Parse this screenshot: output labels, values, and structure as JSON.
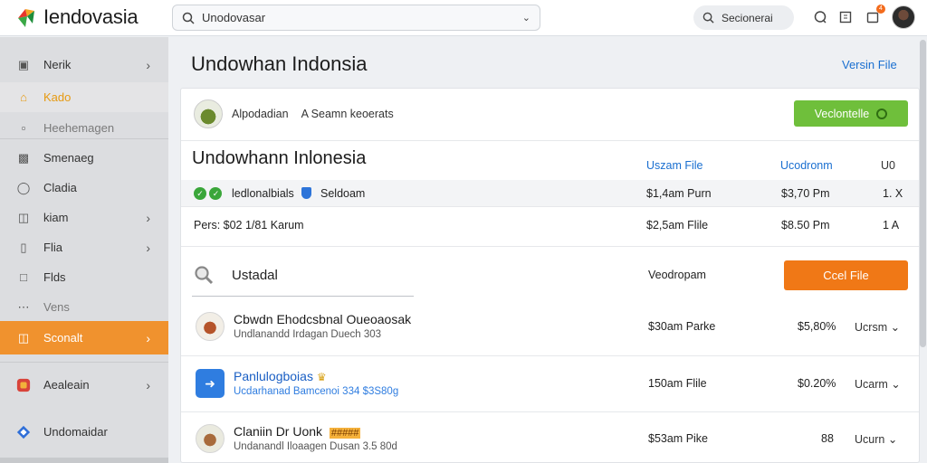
{
  "app": {
    "name": "Iendovasia",
    "search_value": "Unodovasar",
    "pill_label": "Secionerai",
    "notification_count": "4"
  },
  "sidebar": {
    "items": [
      {
        "label": "Nerik",
        "icon": "square-icon"
      },
      {
        "label": "Kado",
        "icon": "home-icon"
      },
      {
        "label": "Heehemagen",
        "icon": "folder-icon"
      },
      {
        "label": "Smenaeg",
        "icon": "grid-icon"
      },
      {
        "label": "Cladia",
        "icon": "circle-icon"
      },
      {
        "label": "kiam",
        "icon": "tag-icon"
      },
      {
        "label": "Flia",
        "icon": "file-icon"
      },
      {
        "label": "Flds",
        "icon": "box-icon"
      },
      {
        "label": "Vens",
        "icon": "dots-icon"
      },
      {
        "label": "Sconalt",
        "icon": "layers-icon"
      },
      {
        "label": "Aealeain",
        "icon": "app-icon"
      },
      {
        "label": "Undomaidar",
        "icon": "diamond-icon"
      }
    ]
  },
  "main": {
    "title": "Undowhan Indonsia",
    "version_link": "Versin File"
  },
  "card": {
    "header_name": "Alpodadian",
    "header_tag": "A  Seamn keoerats",
    "green_button": "Veclontelle",
    "subtitle": "Undowhann Inlonesia",
    "columns": [
      "Uszam File",
      "Ucodronm",
      "U0"
    ],
    "rows": [
      {
        "name": "ledlonalbials",
        "tag": "Seldoam",
        "c1": "$1,4am Purn",
        "c2": "$3,70 Pm",
        "c3": "1. X"
      },
      {
        "name": "Pers:  $02 1/81 Karum",
        "tag": "",
        "c1": "$2,5am Flile",
        "c2": "$8.50 Pm",
        "c3": "1 A"
      }
    ],
    "search_label": "Ustadal",
    "vd_label": "Veodropam",
    "orange_button": "Ccel File",
    "list": [
      {
        "title": "Cbwdn Ehodcsbnal Oueoaosak",
        "sub": "Undlanandd Irdagan Duech 303",
        "c1": "$30am Parke",
        "c2": "$5,80%",
        "c3": "Ucrsm",
        "highlight": ""
      },
      {
        "title": "Panlulogboias",
        "sub": "Ucdarhanad Bamcenoi 334 $3S80g",
        "c1": "150am Flile",
        "c2": "$0.20%",
        "c3": "Ucarm",
        "highlight": ""
      },
      {
        "title": "Claniin Dr Uonk",
        "sub": "Undanandl Iloaagen Dusan 3.5 80d",
        "c1": "$53am Pike",
        "c2": "88",
        "c3": "Ucurn",
        "highlight": "#####"
      }
    ]
  }
}
